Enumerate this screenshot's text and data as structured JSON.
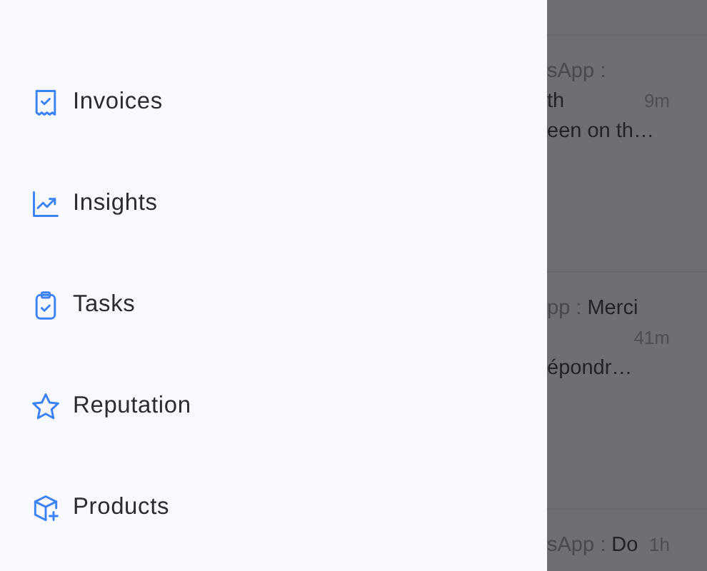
{
  "drawer": {
    "items": [
      {
        "label": "Invoices"
      },
      {
        "label": "Insights"
      },
      {
        "label": "Tasks"
      },
      {
        "label": "Reputation"
      },
      {
        "label": "Products"
      }
    ]
  },
  "conversations": [
    {
      "source": "sApp :",
      "line_2": "th",
      "time": "9m",
      "line_3": "een on th…"
    },
    {
      "source": "pp :",
      "preview": "Merci",
      "time": "41m",
      "line_3": "épondr…"
    },
    {
      "source": "sApp :",
      "preview": "Do",
      "time": "1h"
    }
  ]
}
